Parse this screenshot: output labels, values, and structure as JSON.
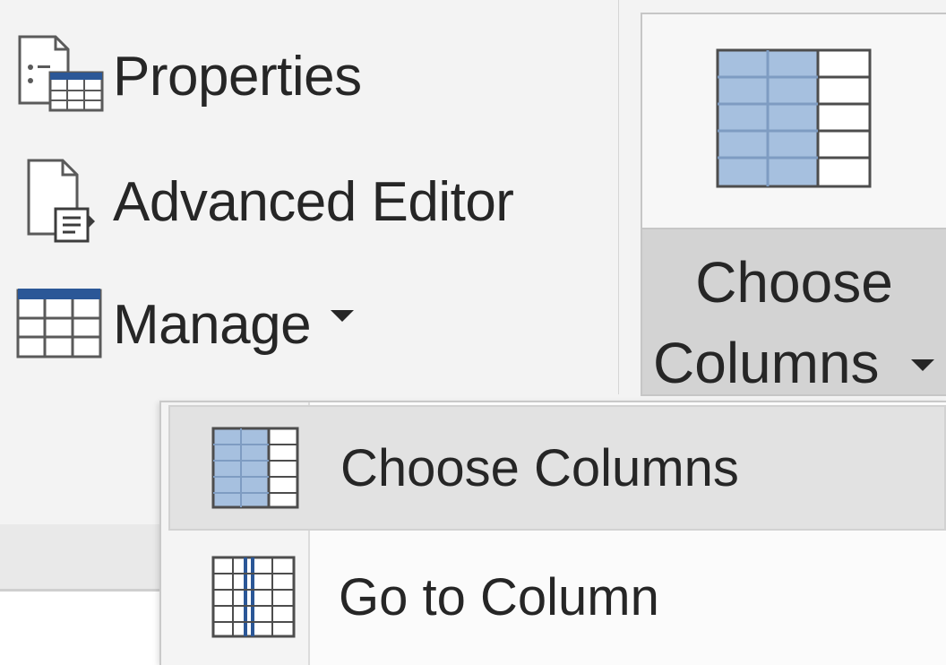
{
  "ribbon": {
    "commands": [
      {
        "label": "Properties",
        "icon": "properties-icon"
      },
      {
        "label": "Advanced Editor",
        "icon": "advanced-editor-icon"
      },
      {
        "label": "Manage",
        "icon": "manage-table-icon",
        "has_dropdown": true
      }
    ],
    "choose_columns_button": {
      "line1": "Choose",
      "line2": "Columns",
      "icon": "choose-columns-icon",
      "has_dropdown": true
    }
  },
  "dropdown_menu": {
    "items": [
      {
        "label": "Choose Columns",
        "icon": "choose-columns-icon",
        "highlighted": true
      },
      {
        "label": "Go to Column",
        "icon": "go-to-column-icon",
        "highlighted": false
      }
    ]
  },
  "colors": {
    "ribbon_bg": "#f3f3f3",
    "button_pressed_bg": "#d3d3d3",
    "menu_hover_bg": "#e2e2e2",
    "icon_blue_fill": "#a6c0df",
    "icon_blue_stroke": "#2b5797",
    "text": "#262626"
  }
}
